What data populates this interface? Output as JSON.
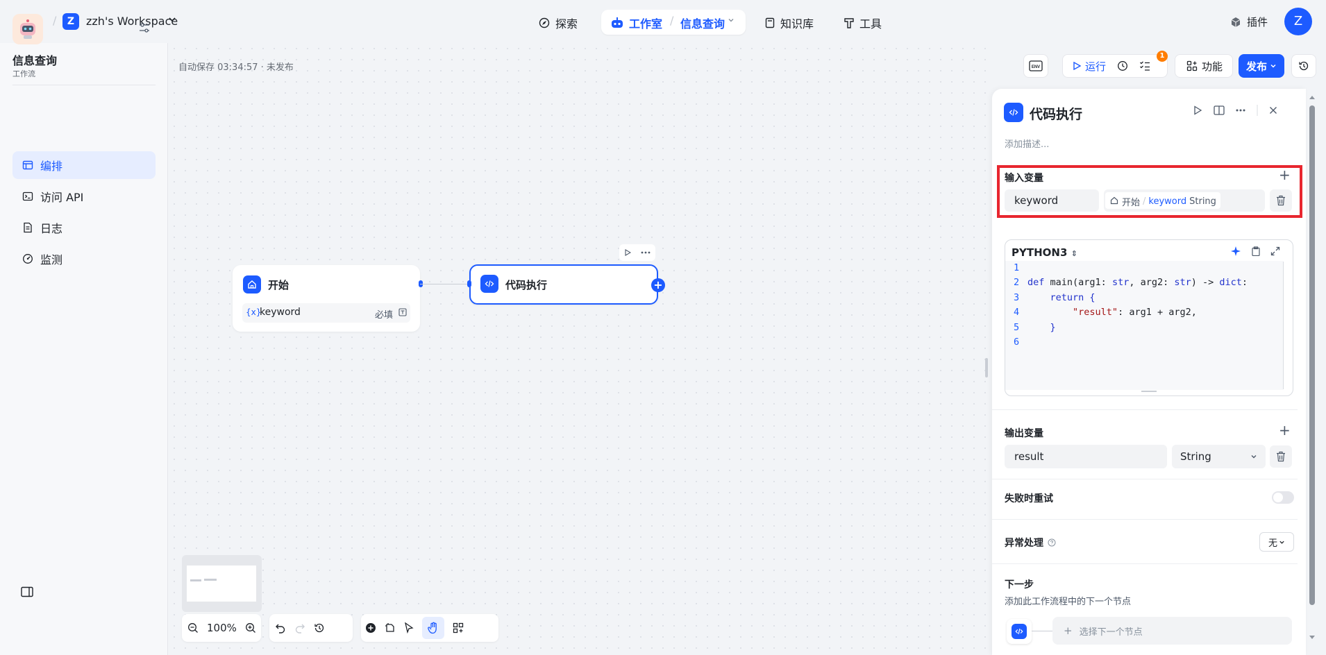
{
  "header": {
    "workspace_initial": "Z",
    "workspace_name": "zzh's Workspace",
    "nav": [
      {
        "label": "探索",
        "icon": "compass-icon"
      },
      {
        "label": "知识库",
        "icon": "book-icon"
      },
      {
        "label": "工具",
        "icon": "hammer-icon"
      }
    ],
    "studio_label": "工作室",
    "studio_app": "信息查询",
    "plugin_label": "插件",
    "user_initial": "Z"
  },
  "sidebar": {
    "app_name": "信息查询",
    "app_type": "工作流",
    "items": [
      {
        "label": "编排",
        "icon": "layout-icon",
        "active": true
      },
      {
        "label": "访问 API",
        "icon": "terminal-icon",
        "active": false
      },
      {
        "label": "日志",
        "icon": "log-icon",
        "active": false
      },
      {
        "label": "监测",
        "icon": "monitor-icon",
        "active": false
      }
    ]
  },
  "canvas": {
    "autosave": "自动保存 03:34:57 · 未发布",
    "start_node": {
      "title": "开始",
      "var_symbol": "{x}",
      "var_name": "keyword",
      "required": "必填"
    },
    "code_node": {
      "title": "代码执行"
    },
    "zoom": "100%"
  },
  "toolbar": {
    "env": "ENV",
    "run": "运行",
    "checklist_count": "1",
    "features": "功能",
    "publish": "发布"
  },
  "panel": {
    "title": "代码执行",
    "description_placeholder": "添加描述...",
    "input_section": "输入变量",
    "input_var_name": "keyword",
    "ref_node": "开始",
    "ref_sep": "/",
    "ref_var": "keyword",
    "ref_type": "String",
    "language": "PYTHON3",
    "code": {
      "l1": "",
      "l2_kw": "def",
      "l2_rest": " main(arg1: ",
      "l2_t1": "str",
      "l2_mid": ", arg2: ",
      "l2_t2": "str",
      "l2_end": ") -> ",
      "l2_t3": "dict",
      "l2_colon": ":",
      "l3_kw": "return",
      "l3_rest": " {",
      "l4_str": "\"result\"",
      "l4_rest": ": arg1 + arg2,",
      "l5": "}",
      "l6": ""
    },
    "line_numbers": [
      "1",
      "2",
      "3",
      "4",
      "5",
      "6"
    ],
    "output_section": "输出变量",
    "output_var_name": "result",
    "output_type": "String",
    "retry_label": "失败时重试",
    "exception_label": "异常处理",
    "exception_value": "无",
    "next_title": "下一步",
    "next_desc": "添加此工作流程中的下一个节点",
    "next_select": "选择下一个节点"
  },
  "colors": {
    "accent": "#1d5bff",
    "highlight_box": "#e8262f",
    "badge": "#ff7d00"
  }
}
